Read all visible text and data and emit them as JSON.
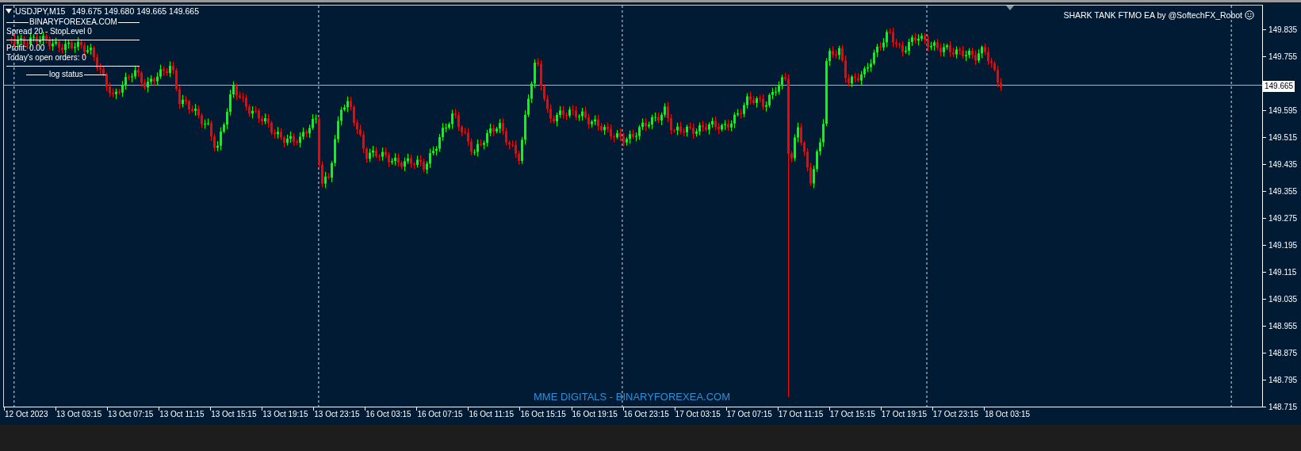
{
  "chart": {
    "symbol": "USDJPY,M15",
    "ohlc": "149.675 149.680 149.665 149.665",
    "info_panel": {
      "brand": "BINARYFOREXEA.COM",
      "spread": "Spread 20 - StopLevel 0",
      "profit": "Profit: 0.00",
      "open_orders": "Today's open orders: 0",
      "log_status": "log status"
    },
    "ea_label": "SHARK TANK FTMO EA by @SoftechFX_Robot",
    "footer_label": "MME DIGITALS - BINARYFOREXEA.COM",
    "current_price": "149.665",
    "price_axis": [
      "149.835",
      "149.755",
      "149.595",
      "149.515",
      "149.435",
      "149.355",
      "149.275",
      "149.195",
      "149.115",
      "149.035",
      "148.955",
      "148.875",
      "148.795",
      "148.715"
    ],
    "time_axis": [
      "12 Oct 2023",
      "13 Oct 03:15",
      "13 Oct 07:15",
      "13 Oct 11:15",
      "13 Oct 15:15",
      "13 Oct 19:15",
      "13 Oct 23:15",
      "16 Oct 03:15",
      "16 Oct 07:15",
      "16 Oct 11:15",
      "16 Oct 15:15",
      "16 Oct 19:15",
      "16 Oct 23:15",
      "17 Oct 03:15",
      "17 Oct 07:15",
      "17 Oct 11:15",
      "17 Oct 15:15",
      "17 Oct 19:15",
      "17 Oct 23:15",
      "18 Oct 03:15"
    ]
  }
}
